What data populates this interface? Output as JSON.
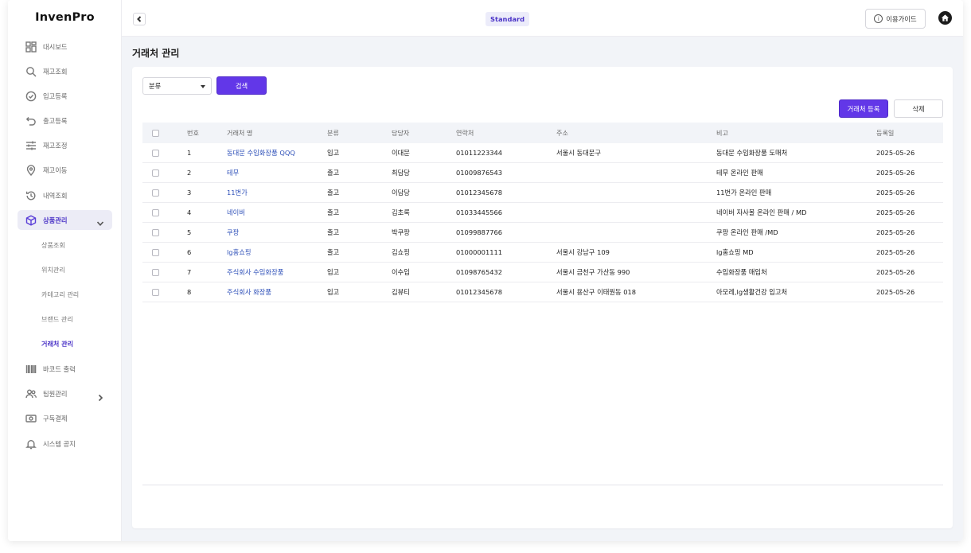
{
  "app": {
    "logo": "InvenPro",
    "plan": "Standard",
    "guide_label": "이용가이드"
  },
  "sidebar": {
    "items": [
      {
        "label": "대시보드",
        "icon": "grid-icon"
      },
      {
        "label": "재고조회",
        "icon": "search-icon"
      },
      {
        "label": "입고등록",
        "icon": "check-circle-icon"
      },
      {
        "label": "출고등록",
        "icon": "undo-icon"
      },
      {
        "label": "재고조정",
        "icon": "sliders-icon"
      },
      {
        "label": "재고이동",
        "icon": "location-pin-icon"
      },
      {
        "label": "내역조회",
        "icon": "history-icon"
      },
      {
        "label": "상품관리",
        "icon": "box-icon"
      },
      {
        "label": "바코드 출력",
        "icon": "barcode-icon"
      },
      {
        "label": "팀원관리",
        "icon": "users-icon"
      },
      {
        "label": "구독결제",
        "icon": "payment-icon"
      },
      {
        "label": "시스템 공지",
        "icon": "bell-icon"
      }
    ],
    "sub_items": [
      {
        "label": "상품조회"
      },
      {
        "label": "위치관리"
      },
      {
        "label": "카테고리 관리"
      },
      {
        "label": "브랜드 관리"
      },
      {
        "label": "거래처 관리"
      }
    ]
  },
  "page": {
    "title": "거래처 관리"
  },
  "filters": {
    "select_value": "분류",
    "search_label": "검색"
  },
  "actions": {
    "register_label": "거래처 등록",
    "delete_label": "삭제"
  },
  "table": {
    "headers": [
      "번호",
      "거래처 명",
      "분류",
      "담당자",
      "연락처",
      "주소",
      "비고",
      "등록일"
    ],
    "rows": [
      [
        "1",
        "동대문 수입화장품 QQQ",
        "입고",
        "이대문",
        "01011223344",
        "서울시 동대문구",
        "동대문 수입화장품 도매처",
        "2025-05-26"
      ],
      [
        "2",
        "테무",
        "출고",
        "최담당",
        "01009876543",
        "",
        "테무 온라인 판매",
        "2025-05-26"
      ],
      [
        "3",
        "11번가",
        "출고",
        "이담당",
        "01012345678",
        "",
        "11번가 온라인 판매",
        "2025-05-26"
      ],
      [
        "4",
        "네이버",
        "출고",
        "김초록",
        "01033445566",
        "",
        "네이버 자사몰 온라인 판매 / MD",
        "2025-05-26"
      ],
      [
        "5",
        "쿠팡",
        "출고",
        "박쿠팡",
        "01099887766",
        "",
        "쿠팡 온라인 판매 /MD",
        "2025-05-26"
      ],
      [
        "6",
        "lg홈쇼핑",
        "출고",
        "김쇼핑",
        "01000001111",
        "서울시 강남구 109",
        "lg홈쇼핑 MD",
        "2025-05-26"
      ],
      [
        "7",
        "주식회사 수입화장품",
        "입고",
        "이수입",
        "01098765432",
        "서울시 금천구 가산동 990",
        "수입화장품 매입처",
        "2025-05-26"
      ],
      [
        "8",
        "주식회사 화장품",
        "입고",
        "김뷰티",
        "01012345678",
        "서울시 용산구 이태원동 018",
        "아모레,lg생활건강 입고처",
        "2025-05-26"
      ]
    ]
  },
  "colors": {
    "accent": "#6237e8",
    "active_text": "#4b34c7",
    "link": "#2d4fb8",
    "page_bg": "#f2f4f8"
  }
}
